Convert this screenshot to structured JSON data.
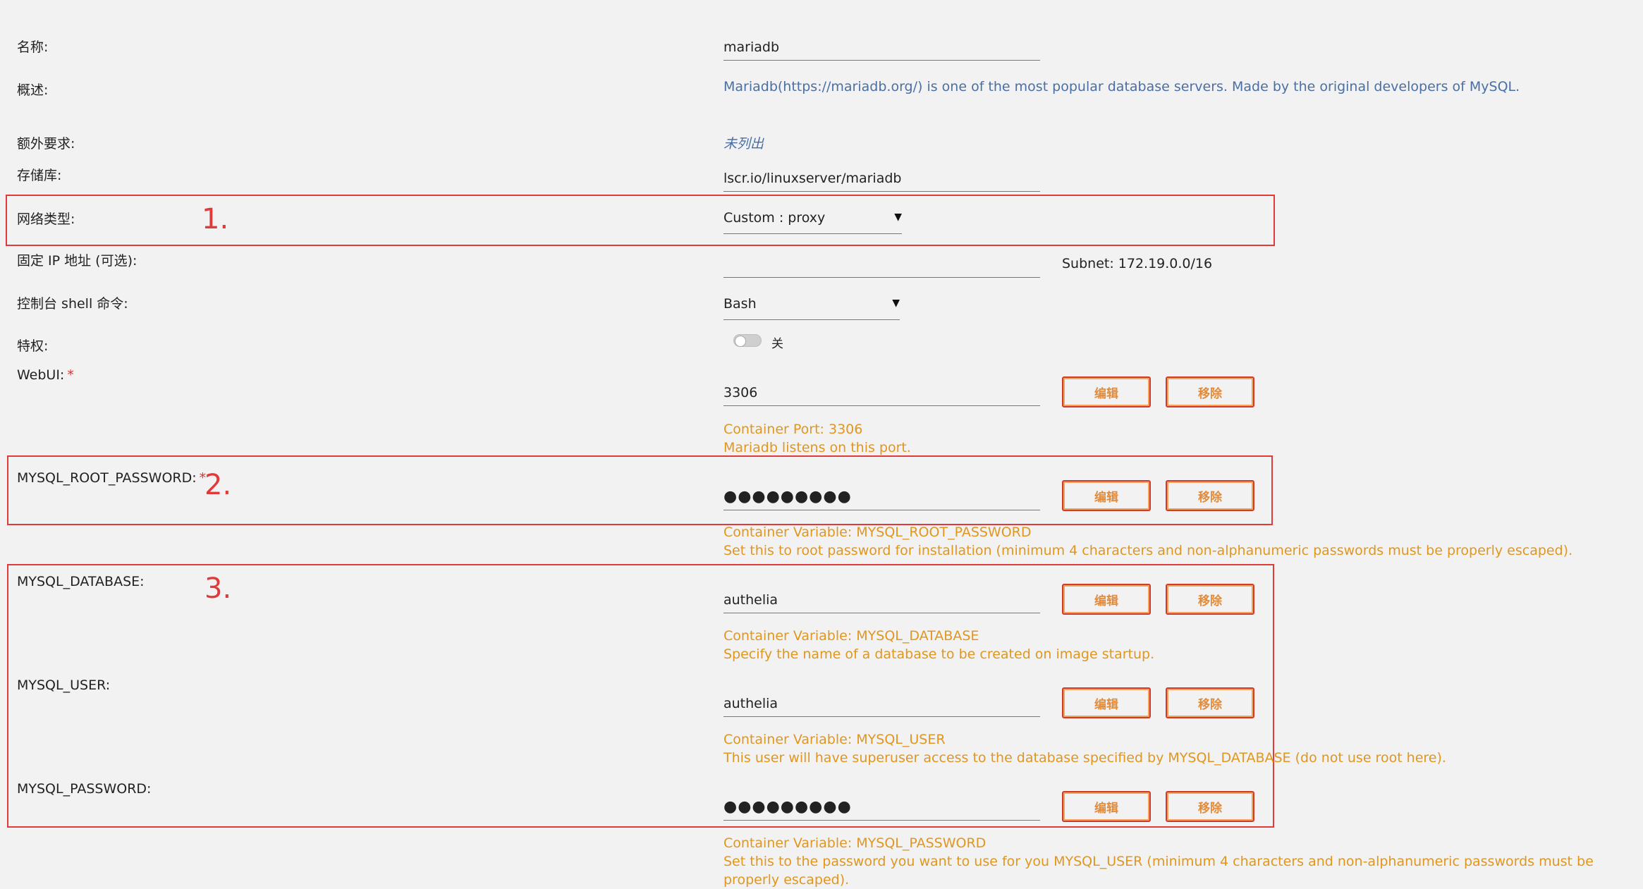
{
  "form": {
    "name": {
      "label": "名称:",
      "value": "mariadb"
    },
    "overview": {
      "label": "概述:",
      "value": "Mariadb(https://mariadb.org/) is one of the most popular database servers. Made by the original developers of MySQL."
    },
    "extra_requirements": {
      "label": "额外要求:",
      "value": "未列出"
    },
    "repository": {
      "label": "存储库:",
      "value": "lscr.io/linuxserver/mariadb"
    },
    "network_type": {
      "label": "网络类型:",
      "value": "Custom : proxy",
      "annotation": "1."
    },
    "fixed_ip": {
      "label": "固定 IP 地址 (可选):",
      "value": "",
      "subnet": "Subnet: 172.19.0.0/16"
    },
    "console_shell": {
      "label": "控制台 shell 命令:",
      "value": "Bash"
    },
    "privileged": {
      "label": "特权:",
      "state": "关",
      "on": false
    },
    "webui": {
      "label": "WebUI:",
      "required": "*",
      "value": "3306",
      "hint1": "Container Port: 3306",
      "hint2": "Mariadb listens on this port."
    },
    "mysql_root_password": {
      "label": "MYSQL_ROOT_PASSWORD:",
      "required": "*",
      "value": "●●●●●●●●●",
      "annotation": "2.",
      "hint1": "Container Variable: MYSQL_ROOT_PASSWORD",
      "hint2": "Set this to root password for installation (minimum 4 characters and non-alphanumeric passwords must be properly escaped)."
    },
    "mysql_database": {
      "label": "MYSQL_DATABASE:",
      "value": "authelia",
      "annotation": "3.",
      "hint1": "Container Variable: MYSQL_DATABASE",
      "hint2": "Specify the name of a database to be created on image startup."
    },
    "mysql_user": {
      "label": "MYSQL_USER:",
      "value": "authelia",
      "hint1": "Container Variable: MYSQL_USER",
      "hint2": "This user will have superuser access to the database specified by MYSQL_DATABASE (do not use root here)."
    },
    "mysql_password": {
      "label": "MYSQL_PASSWORD:",
      "value": "●●●●●●●●●",
      "hint1": "Container Variable: MYSQL_PASSWORD",
      "hint2": "Set this to the password you want to use for you MYSQL_USER (minimum 4 characters and non-alphanumeric passwords must be properly escaped)."
    }
  },
  "buttons": {
    "edit": "编辑",
    "remove": "移除"
  },
  "colors": {
    "annotation_red": "#e03a3a",
    "hint_orange": "#e0961f",
    "desc_blue": "#4a6fa5",
    "button_border": "#d13b2b"
  }
}
